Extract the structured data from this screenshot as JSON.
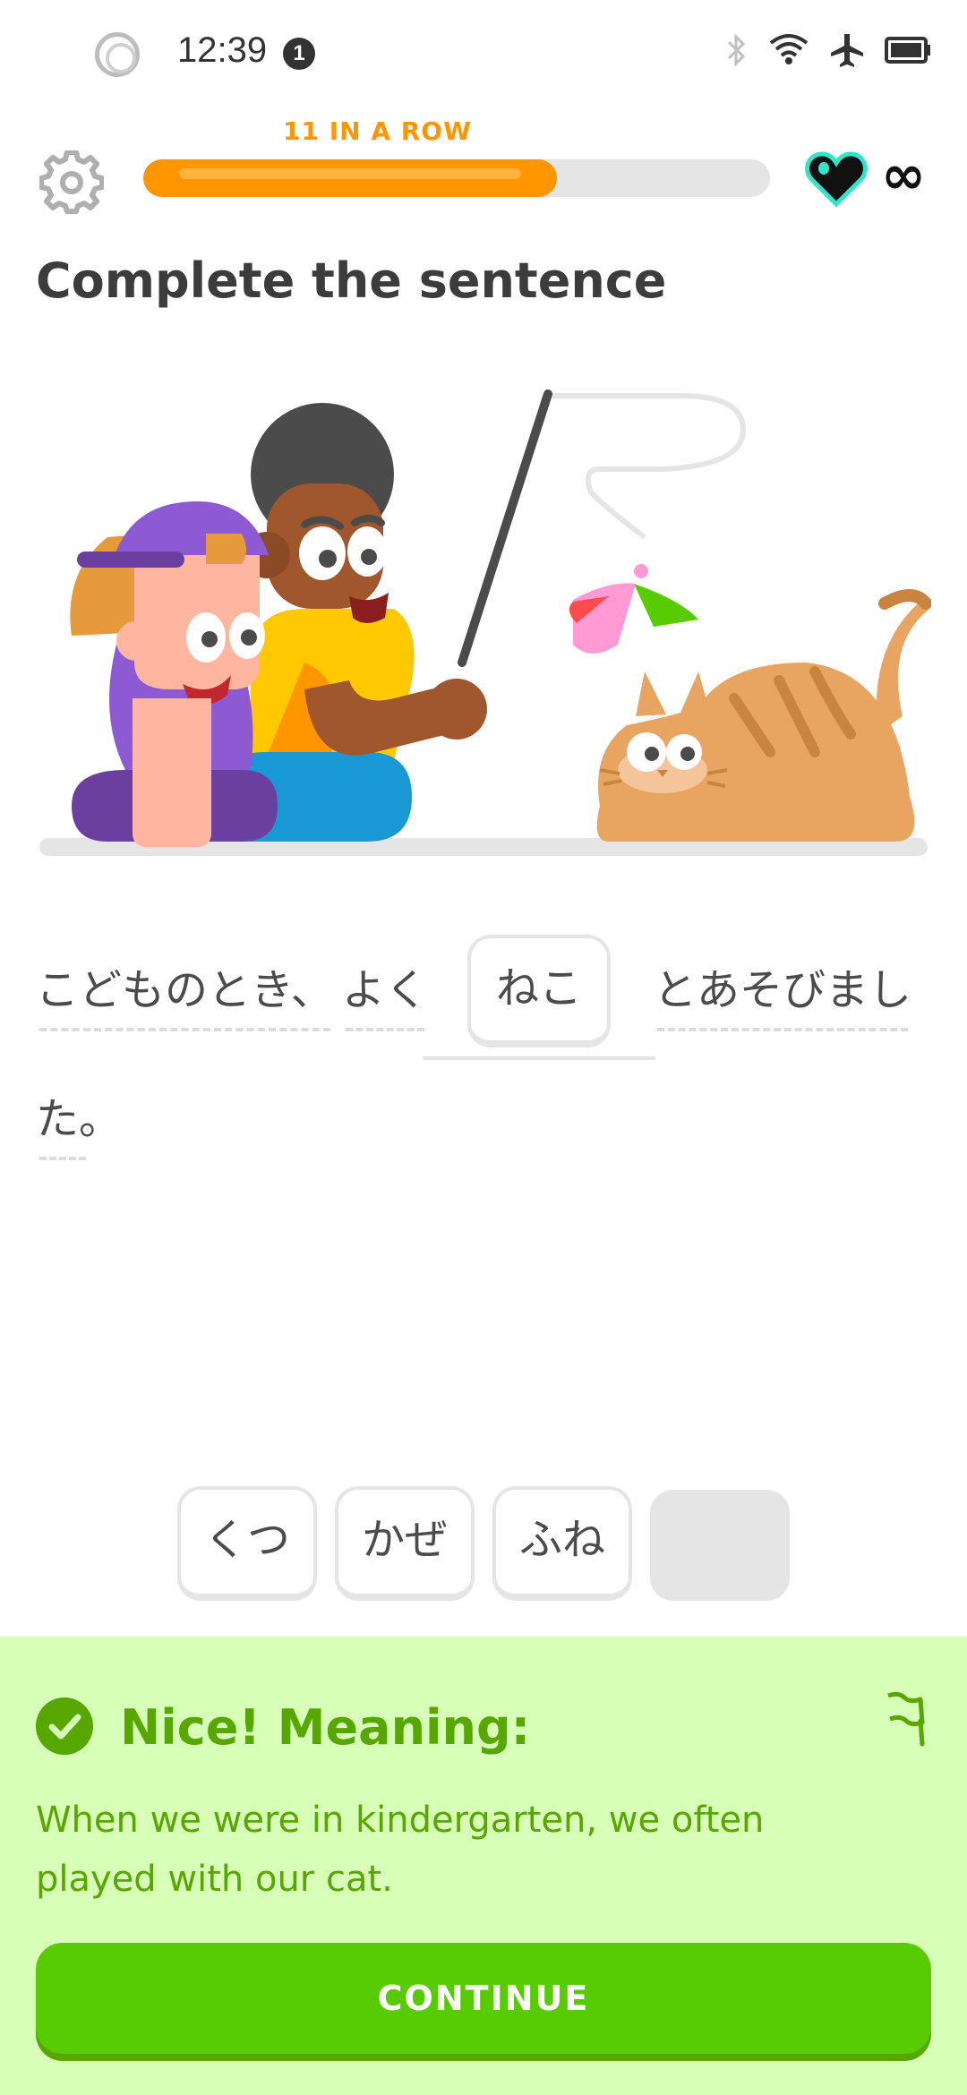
{
  "status_bar": {
    "time": "12:39",
    "notification_count": "1",
    "icons": [
      "bluetooth-icon",
      "wifi-icon",
      "airplane-icon",
      "battery-icon"
    ]
  },
  "header": {
    "streak_label": "11 IN A ROW",
    "progress_fraction": 0.66,
    "hearts_value": "∞"
  },
  "page_title": "Complete the sentence",
  "sentence": {
    "words": [
      "こどものとき、",
      "よく",
      "とあそびまし",
      "た。"
    ],
    "answer": "ねこ"
  },
  "word_bank": [
    "くつ",
    "かぜ",
    "ふね"
  ],
  "feedback": {
    "title": "Nice! Meaning:",
    "body": "When we were in kindergarten, we often played with our cat.",
    "continue_label": "CONTINUE"
  },
  "colors": {
    "accent_orange": "#ff9600",
    "success_green": "#58a700",
    "button_green": "#58cc02",
    "feedback_bg": "#d7ffb8"
  }
}
